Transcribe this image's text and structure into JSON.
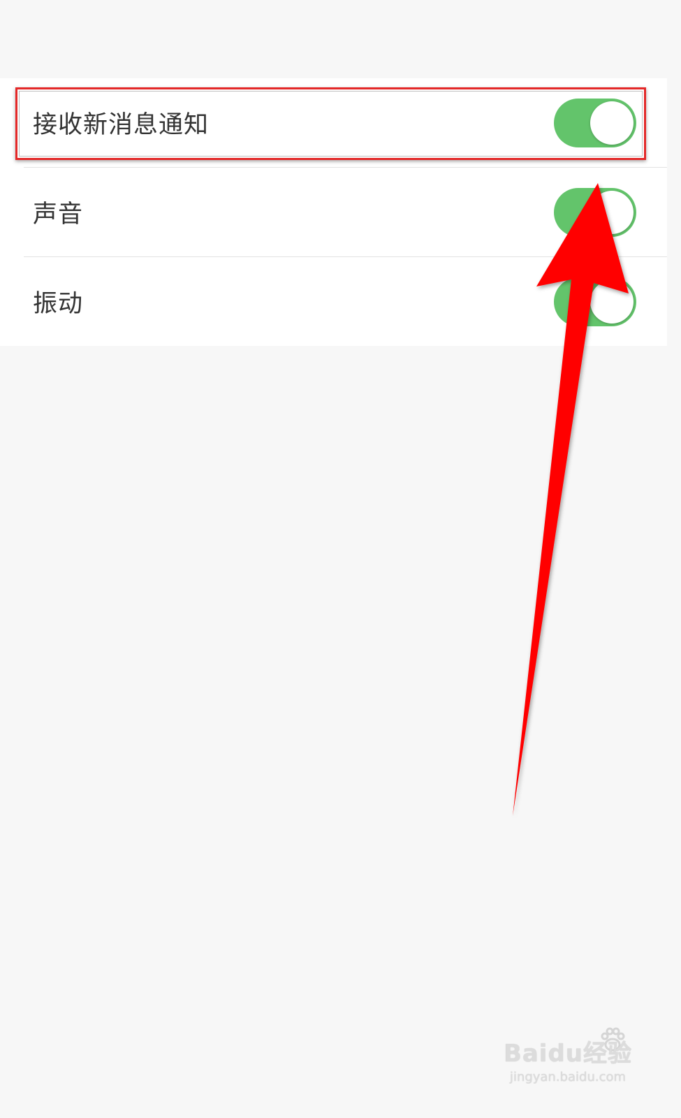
{
  "settings": {
    "items": [
      {
        "label": "接收新消息通知",
        "enabled": true,
        "highlighted": true
      },
      {
        "label": "声音",
        "enabled": true,
        "highlighted": false
      },
      {
        "label": "振动",
        "enabled": true,
        "highlighted": false
      }
    ]
  },
  "colors": {
    "toggle_on": "#63c46b",
    "annotation": "#e42828",
    "arrow": "#ff0000",
    "background": "#f7f7f7"
  },
  "watermark": {
    "brand": "Baidu经验",
    "url": "jingyan.baidu.com"
  }
}
